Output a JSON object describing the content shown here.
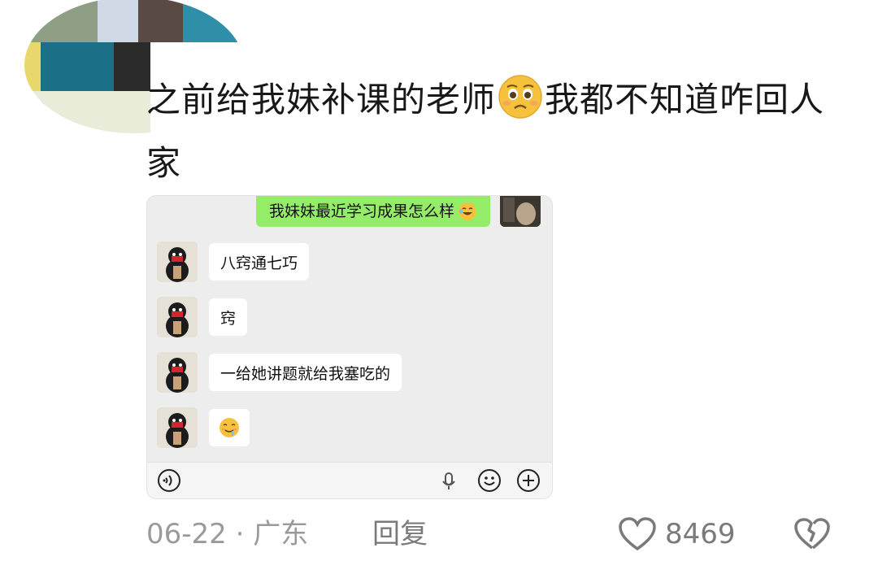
{
  "comment": {
    "text_part1": "之前给我妹补课的老师",
    "text_part2": "我都不知道咋回人家",
    "emoji_inline": "pleading-emoji"
  },
  "chat": {
    "sent_message": "我妹妹最近学习成果怎么样",
    "sent_emoji": "laughing-emoji",
    "messages": [
      {
        "text": "八窍通七巧"
      },
      {
        "text": "窍"
      },
      {
        "text": "一给她讲题就给我塞吃的"
      },
      {
        "text": "",
        "emoji": "drooling-emoji"
      }
    ],
    "input_icons": [
      "voice-icon",
      "microphone-icon",
      "emoji-icon",
      "plus-icon"
    ]
  },
  "footer": {
    "date": "06-22",
    "separator": "·",
    "location": "广东",
    "reply_label": "回复",
    "like_count": "8469",
    "like_icon": "heart-outline-icon",
    "dislike_icon": "broken-heart-icon"
  },
  "colors": {
    "chat_bg": "#ededed",
    "sent_bubble": "#95ec69",
    "received_bubble": "#ffffff",
    "meta_text": "#9a9a9a"
  }
}
